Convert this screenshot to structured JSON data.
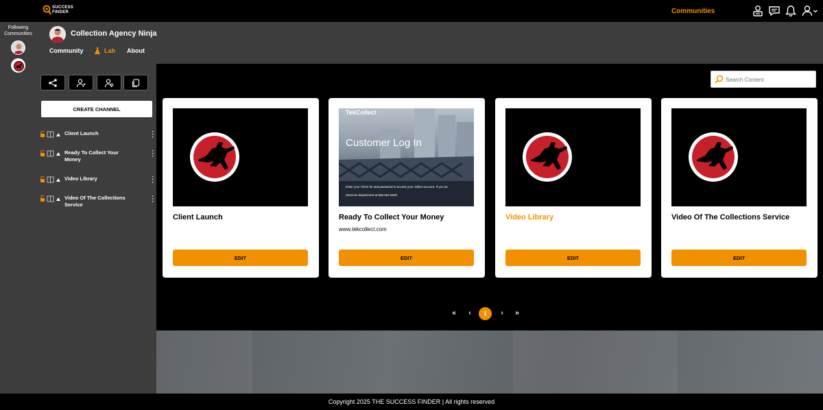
{
  "brand": {
    "name_line1": "SUCCESS",
    "name_line2": "FINDER"
  },
  "top_nav": {
    "communities_label": "Communities"
  },
  "following": {
    "label": "Following Communities"
  },
  "community": {
    "name": "Collection Agency Ninja",
    "tabs": [
      {
        "label": "Community"
      },
      {
        "label": "Lab"
      },
      {
        "label": "About"
      }
    ]
  },
  "sidebar": {
    "create_channel_label": "CREATE CHANNEL",
    "channels": [
      {
        "label": "Client Launch"
      },
      {
        "label": "Ready To Collect Your Money"
      },
      {
        "label": "Video Library"
      },
      {
        "label": "Video Of The Collections Service"
      }
    ]
  },
  "search": {
    "placeholder": "Search Content"
  },
  "cards": [
    {
      "title": "Client Launch",
      "url": "",
      "edit_label": "EDIT"
    },
    {
      "title": "Ready To Collect Your Money",
      "url": "www.tekcollect.com",
      "edit_label": "EDIT"
    },
    {
      "title": "Video Library",
      "url": "",
      "edit_label": "EDIT"
    },
    {
      "title": "Video Of The Collections Service",
      "url": "",
      "edit_label": "EDIT"
    }
  ],
  "tekcollect_thumb": {
    "logo": "TekCollect",
    "heading": "Customer Log In",
    "line1": "Enter your Client ID and password to access your online account. If you do",
    "line2": "Services department at 866.652.6500."
  },
  "pagination": {
    "first": "«",
    "prev": "‹",
    "current": "1",
    "next": "›",
    "last": "»"
  },
  "footer": {
    "copyright": "Copyright 2025 THE SUCCESS FINDER | All rights reserved"
  },
  "colors": {
    "accent": "#f29100",
    "panel": "#3d3d3d",
    "background": "#000000",
    "ninja_red": "#c8202a"
  }
}
